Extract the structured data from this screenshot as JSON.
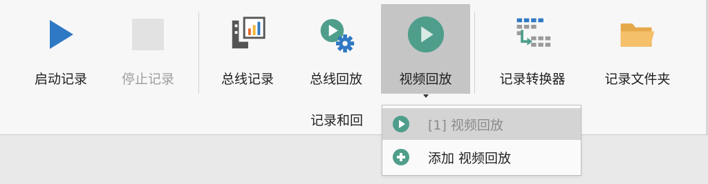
{
  "toolbar": {
    "buttons": [
      {
        "label": "启动记录",
        "icon": "play-icon",
        "enabled": true
      },
      {
        "label": "停止记录",
        "icon": "stop-icon",
        "enabled": false
      },
      {
        "label": "总线记录",
        "icon": "bus-log-icon",
        "enabled": true
      },
      {
        "label": "总线回放",
        "icon": "bus-replay-icon",
        "enabled": true
      },
      {
        "label": "视频回放",
        "icon": "video-replay-icon",
        "enabled": true,
        "active": true
      },
      {
        "label": "记录转换器",
        "icon": "log-converter-icon",
        "enabled": true
      },
      {
        "label": "记录文件夹",
        "icon": "folder-icon",
        "enabled": true
      }
    ],
    "group_label": "记录和回"
  },
  "dropdown": {
    "items": [
      {
        "label": "[1] 视频回放",
        "icon": "video-play-circle-icon",
        "selected": true
      },
      {
        "label": "添加 视频回放",
        "icon": "add-circle-icon",
        "selected": false
      }
    ]
  },
  "colors": {
    "play_blue": "#2f78c4",
    "teal": "#4f9e8b",
    "gear_blue": "#2f78c4",
    "folder": "#f0b55a",
    "active_bg": "#c5c5c5"
  }
}
